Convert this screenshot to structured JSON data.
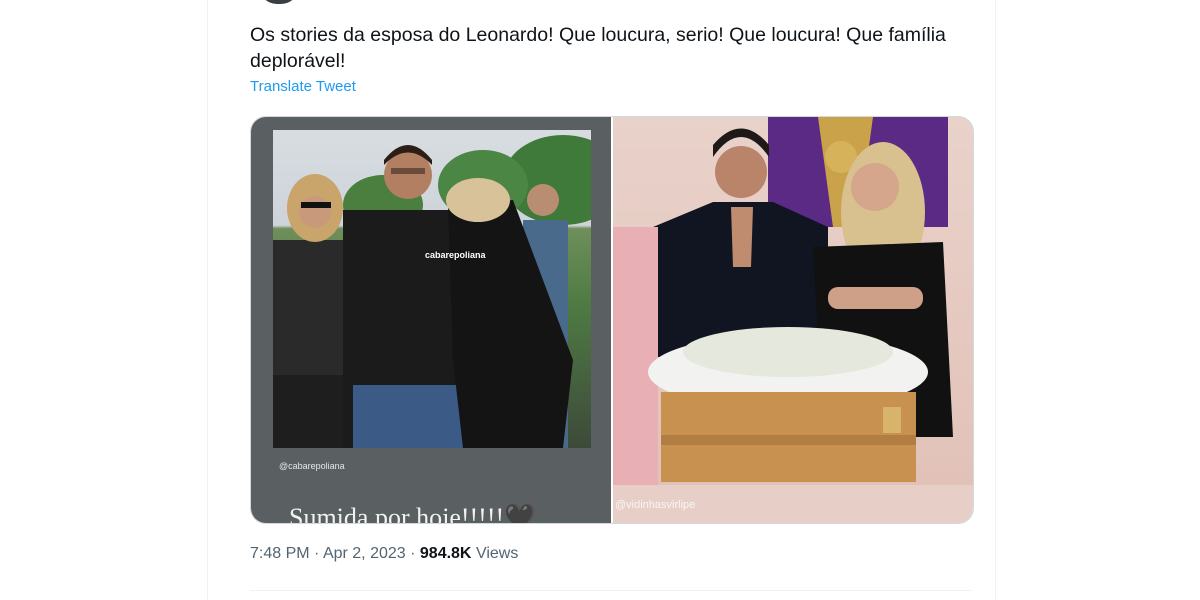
{
  "tweet": {
    "text": "Os stories da esposa do Leonardo! Que loucura, serio! Que loucura! Que família deplorável!",
    "translate_label": "Translate Tweet"
  },
  "media": {
    "left": {
      "shirt_text": "cabarepoliana",
      "handle": "@cabarepoliana",
      "caption": "Sumida por hoje!!!!!🖤"
    },
    "right": {
      "handle": "@vidinhasvirlipe"
    }
  },
  "meta": {
    "time": "7:48 PM",
    "separator": " · ",
    "date": "Apr 2, 2023",
    "views_count": "984.8K",
    "views_label": "Views"
  }
}
